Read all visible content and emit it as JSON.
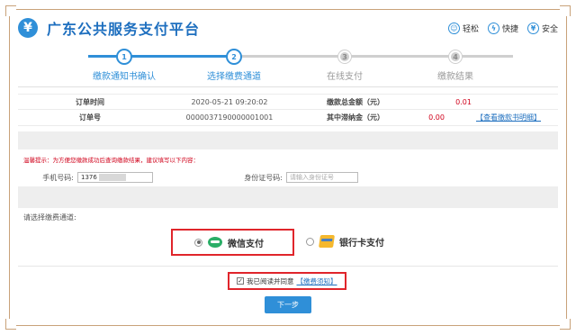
{
  "header": {
    "logo_glyph": "¥",
    "title": "广东公共服务支付平台",
    "badges": [
      {
        "icon": "smile-icon",
        "glyph": "☺",
        "label": "轻松"
      },
      {
        "icon": "lightning-icon",
        "glyph": "ϟ",
        "label": "快捷"
      },
      {
        "icon": "shield-yen-icon",
        "glyph": "¥",
        "label": "安全"
      }
    ]
  },
  "steps": [
    {
      "num": "1",
      "label": "缴款通知书确认",
      "state": "done"
    },
    {
      "num": "2",
      "label": "选择缴费通道",
      "state": "current"
    },
    {
      "num": "3",
      "label": "在线支付",
      "state": "todo"
    },
    {
      "num": "4",
      "label": "缴款结果",
      "state": "todo"
    }
  ],
  "order": {
    "time_label": "订单时间",
    "time_value": "2020-05-21 09:20:02",
    "total_label": "缴款总金额（元）",
    "total_value": "0.01",
    "no_label": "订单号",
    "no_value": "0000037190000001001",
    "late_label": "其中滞纳金（元）",
    "late_value": "0.00",
    "detail_link": "【查看缴款书明细】"
  },
  "tip": "温馨提示：为方便您缴款成功后查询缴款结果，建议填写以下内容：",
  "form": {
    "phone_label": "手机号码:",
    "phone_value": "1376",
    "id_label": "身份证号码:",
    "id_placeholder": "请输入身份证号"
  },
  "channel_label": "请选择缴费通道:",
  "pay": {
    "wechat_label": "微信支付",
    "bank_label": "银行卡支付"
  },
  "agree": {
    "check_mark": "✓",
    "text": "我已阅读并同意",
    "link": "【缴费须知】"
  },
  "next_button": "下一步",
  "colors": {
    "brand_blue": "#2f8fd8",
    "alert_red": "#e0252b",
    "wechat_green": "#2aae67",
    "frame": "#c9a27a"
  }
}
